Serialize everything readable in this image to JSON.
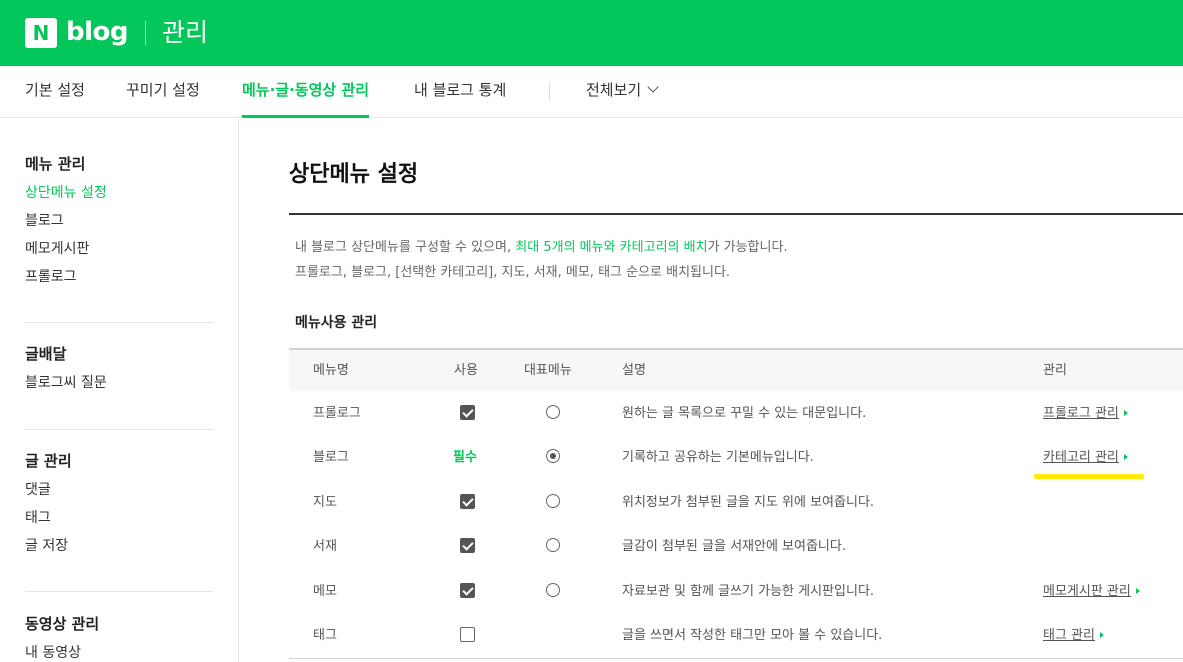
{
  "header": {
    "logo_n": "N",
    "logo_text": "blog",
    "section_title": "관리"
  },
  "tabs": [
    {
      "label": "기본 설정"
    },
    {
      "label": "꾸미기 설정"
    },
    {
      "label": "메뉴·글·동영상 관리"
    },
    {
      "label": "내 블로그 통계"
    },
    {
      "label": "전체보기"
    }
  ],
  "sidebar": {
    "groups": [
      {
        "title": "메뉴 관리",
        "items": [
          "상단메뉴 설정",
          "블로그",
          "메모게시판",
          "프롤로그"
        ]
      },
      {
        "title": "글배달",
        "items": [
          "블로그씨 질문"
        ]
      },
      {
        "title": "글 관리",
        "items": [
          "댓글",
          "태그",
          "글 저장"
        ]
      },
      {
        "title": "동영상 관리",
        "items": [
          "내 동영상"
        ]
      }
    ]
  },
  "main": {
    "title": "상단메뉴 설정",
    "desc_line1_a": "내 블로그 상단메뉴를 구성할 수 있으며, ",
    "desc_line1_highlight": "최대 5개의 메뉴와 카테고리의 배치",
    "desc_line1_b": "가 가능합니다.",
    "desc_line2": "프롤로그, 블로그, [선택한 카테고리], 지도, 서재, 메모, 태그 순으로 배치됩니다.",
    "section_title": "메뉴사용 관리",
    "columns": {
      "name": "메뉴명",
      "use": "사용",
      "main_menu": "대표메뉴",
      "desc": "설명",
      "manage": "관리"
    },
    "rows": [
      {
        "name": "프롤로그",
        "use": "checked",
        "main_menu": "unchecked",
        "desc": "원하는 글 목록으로 꾸밀 수 있는 대문입니다.",
        "manage": "프롤로그 관리"
      },
      {
        "name": "블로그",
        "use": "required",
        "use_label": "필수",
        "main_menu": "checked",
        "desc": "기록하고 공유하는 기본메뉴입니다.",
        "manage": "카테고리 관리"
      },
      {
        "name": "지도",
        "use": "checked",
        "main_menu": "unchecked",
        "desc": "위치정보가 첨부된 글을 지도 위에 보여줍니다.",
        "manage": ""
      },
      {
        "name": "서재",
        "use": "checked",
        "main_menu": "unchecked",
        "desc": "글감이 첨부된 글을 서재안에 보여줍니다.",
        "manage": ""
      },
      {
        "name": "메모",
        "use": "checked",
        "main_menu": "unchecked",
        "desc": "자료보관 및 함께 글쓰기 가능한 게시판입니다.",
        "manage": "메모게시판 관리"
      },
      {
        "name": "태그",
        "use": "unchecked",
        "main_menu": "none",
        "desc": "글을 쓰면서 작성한 태그만 모아 볼 수 있습니다.",
        "manage": "태그 관리"
      }
    ]
  },
  "colors": {
    "brand": "#03c75a",
    "highlight": "#ffec00"
  }
}
